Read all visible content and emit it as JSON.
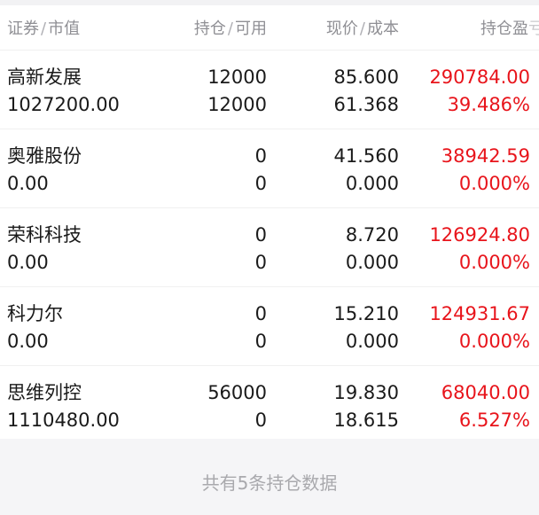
{
  "header": {
    "name_label": "证券",
    "value_label": "市值",
    "position_label": "持仓",
    "available_label": "可用",
    "price_label": "现价",
    "cost_label": "成本",
    "pnl_label_visible": "持仓盈",
    "pnl_label_faded": "亏",
    "separator": "/"
  },
  "holdings": [
    {
      "name": "高新发展",
      "market_value": "1027200.00",
      "position": "12000",
      "available": "12000",
      "price": "85.600",
      "cost": "61.368",
      "pnl": "290784.00",
      "pnl_pct": "39.486%"
    },
    {
      "name": "奥雅股份",
      "market_value": "0.00",
      "position": "0",
      "available": "0",
      "price": "41.560",
      "cost": "0.000",
      "pnl": "38942.59",
      "pnl_pct": "0.000%"
    },
    {
      "name": "荣科科技",
      "market_value": "0.00",
      "position": "0",
      "available": "0",
      "price": "8.720",
      "cost": "0.000",
      "pnl": "126924.80",
      "pnl_pct": "0.000%"
    },
    {
      "name": "科力尔",
      "market_value": "0.00",
      "position": "0",
      "available": "0",
      "price": "15.210",
      "cost": "0.000",
      "pnl": "124931.67",
      "pnl_pct": "0.000%"
    },
    {
      "name": "思维列控",
      "market_value": "1110480.00",
      "position": "56000",
      "available": "0",
      "price": "19.830",
      "cost": "18.615",
      "pnl": "68040.00",
      "pnl_pct": "6.527%"
    }
  ],
  "footer": {
    "summary": "共有5条持仓数据"
  },
  "colors": {
    "profit": "#e8141b",
    "text": "#1a1a1a",
    "muted": "#8f8f94"
  }
}
